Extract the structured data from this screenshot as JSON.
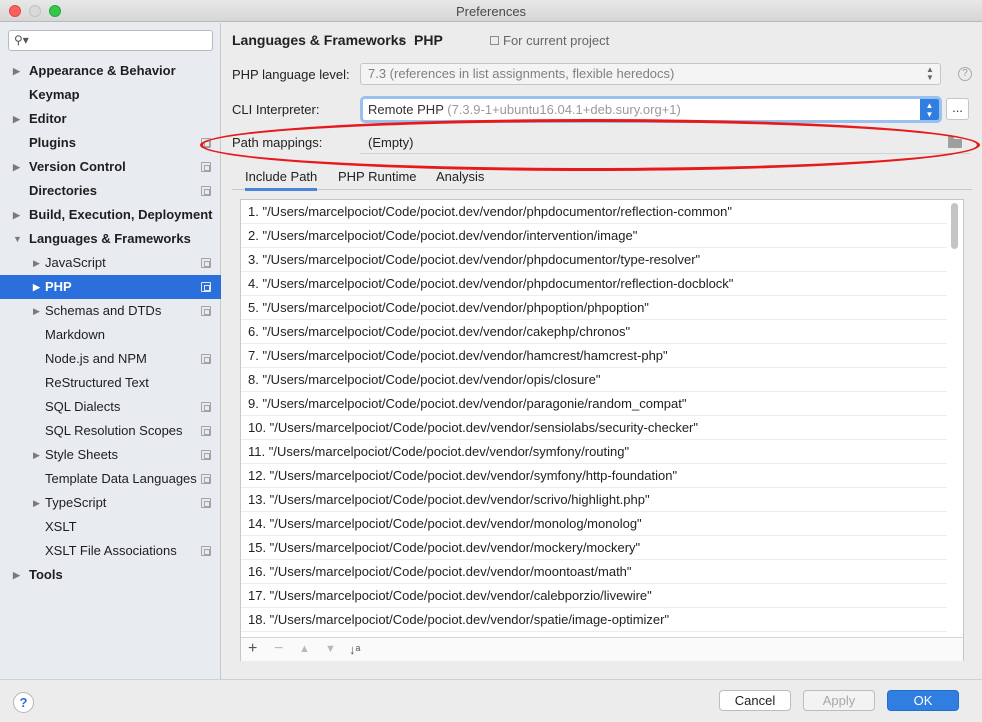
{
  "window": {
    "title": "Preferences"
  },
  "sidebar": {
    "items": [
      {
        "label": "Appearance & Behavior",
        "bold": true,
        "arrow": "right",
        "indent": 0,
        "proj": false,
        "selected": false
      },
      {
        "label": "Keymap",
        "bold": true,
        "arrow": "",
        "indent": 0,
        "proj": false,
        "selected": false
      },
      {
        "label": "Editor",
        "bold": true,
        "arrow": "right",
        "indent": 0,
        "proj": false,
        "selected": false
      },
      {
        "label": "Plugins",
        "bold": true,
        "arrow": "",
        "indent": 0,
        "proj": true,
        "selected": false
      },
      {
        "label": "Version Control",
        "bold": true,
        "arrow": "right",
        "indent": 0,
        "proj": true,
        "selected": false
      },
      {
        "label": "Directories",
        "bold": true,
        "arrow": "",
        "indent": 0,
        "proj": true,
        "selected": false
      },
      {
        "label": "Build, Execution, Deployment",
        "bold": true,
        "arrow": "right",
        "indent": 0,
        "proj": false,
        "selected": false
      },
      {
        "label": "Languages & Frameworks",
        "bold": true,
        "arrow": "down",
        "indent": 0,
        "proj": false,
        "selected": false
      },
      {
        "label": "JavaScript",
        "bold": false,
        "arrow": "right",
        "indent": 1,
        "proj": true,
        "selected": false
      },
      {
        "label": "PHP",
        "bold": true,
        "arrow": "right",
        "indent": 1,
        "proj": true,
        "selected": true
      },
      {
        "label": "Schemas and DTDs",
        "bold": false,
        "arrow": "right",
        "indent": 1,
        "proj": true,
        "selected": false
      },
      {
        "label": "Markdown",
        "bold": false,
        "arrow": "",
        "indent": 1,
        "proj": false,
        "selected": false
      },
      {
        "label": "Node.js and NPM",
        "bold": false,
        "arrow": "",
        "indent": 1,
        "proj": true,
        "selected": false
      },
      {
        "label": "ReStructured Text",
        "bold": false,
        "arrow": "",
        "indent": 1,
        "proj": false,
        "selected": false
      },
      {
        "label": "SQL Dialects",
        "bold": false,
        "arrow": "",
        "indent": 1,
        "proj": true,
        "selected": false
      },
      {
        "label": "SQL Resolution Scopes",
        "bold": false,
        "arrow": "",
        "indent": 1,
        "proj": true,
        "selected": false
      },
      {
        "label": "Style Sheets",
        "bold": false,
        "arrow": "right",
        "indent": 1,
        "proj": true,
        "selected": false
      },
      {
        "label": "Template Data Languages",
        "bold": false,
        "arrow": "",
        "indent": 1,
        "proj": true,
        "selected": false
      },
      {
        "label": "TypeScript",
        "bold": false,
        "arrow": "right",
        "indent": 1,
        "proj": true,
        "selected": false
      },
      {
        "label": "XSLT",
        "bold": false,
        "arrow": "",
        "indent": 1,
        "proj": false,
        "selected": false
      },
      {
        "label": "XSLT File Associations",
        "bold": false,
        "arrow": "",
        "indent": 1,
        "proj": true,
        "selected": false
      },
      {
        "label": "Tools",
        "bold": true,
        "arrow": "right",
        "indent": 0,
        "proj": false,
        "selected": false
      }
    ]
  },
  "header": {
    "breadcrumb": "Languages & Frameworks",
    "separator": "›",
    "current": "PHP",
    "scope": "For current project"
  },
  "form": {
    "language_level_label": "PHP language level:",
    "language_level_value": "7.3 (references in list assignments, flexible heredocs)",
    "cli_label": "CLI Interpreter:",
    "cli_value": "Remote PHP",
    "cli_detail": " (7.3.9-1+ubuntu16.04.1+deb.sury.org+1)",
    "dots": "...",
    "path_mappings_label": "Path mappings:",
    "path_mappings_value": "(Empty)"
  },
  "tabs": [
    "Include Path",
    "PHP Runtime",
    "Analysis"
  ],
  "include_paths": [
    "1. \"/Users/marcelpociot/Code/pociot.dev/vendor/phpdocumentor/reflection-common\"",
    "2. \"/Users/marcelpociot/Code/pociot.dev/vendor/intervention/image\"",
    "3. \"/Users/marcelpociot/Code/pociot.dev/vendor/phpdocumentor/type-resolver\"",
    "4. \"/Users/marcelpociot/Code/pociot.dev/vendor/phpdocumentor/reflection-docblock\"",
    "5. \"/Users/marcelpociot/Code/pociot.dev/vendor/phpoption/phpoption\"",
    "6. \"/Users/marcelpociot/Code/pociot.dev/vendor/cakephp/chronos\"",
    "7. \"/Users/marcelpociot/Code/pociot.dev/vendor/hamcrest/hamcrest-php\"",
    "8. \"/Users/marcelpociot/Code/pociot.dev/vendor/opis/closure\"",
    "9. \"/Users/marcelpociot/Code/pociot.dev/vendor/paragonie/random_compat\"",
    "10. \"/Users/marcelpociot/Code/pociot.dev/vendor/sensiolabs/security-checker\"",
    "11. \"/Users/marcelpociot/Code/pociot.dev/vendor/symfony/routing\"",
    "12. \"/Users/marcelpociot/Code/pociot.dev/vendor/symfony/http-foundation\"",
    "13. \"/Users/marcelpociot/Code/pociot.dev/vendor/scrivo/highlight.php\"",
    "14. \"/Users/marcelpociot/Code/pociot.dev/vendor/monolog/monolog\"",
    "15. \"/Users/marcelpociot/Code/pociot.dev/vendor/mockery/mockery\"",
    "16. \"/Users/marcelpociot/Code/pociot.dev/vendor/moontoast/math\"",
    "17. \"/Users/marcelpociot/Code/pociot.dev/vendor/calebporzio/livewire\"",
    "18. \"/Users/marcelpociot/Code/pociot.dev/vendor/spatie/image-optimizer\""
  ],
  "toolbar": {
    "add": "+",
    "remove": "−",
    "up": "▲",
    "down": "▼",
    "sort": "↓ᵃ"
  },
  "buttons": {
    "help": "?",
    "cancel": "Cancel",
    "apply": "Apply",
    "ok": "OK"
  },
  "colors": {
    "accent": "#2f7ee0",
    "selection": "#2a6fdb",
    "annotation": "#e8191a"
  }
}
